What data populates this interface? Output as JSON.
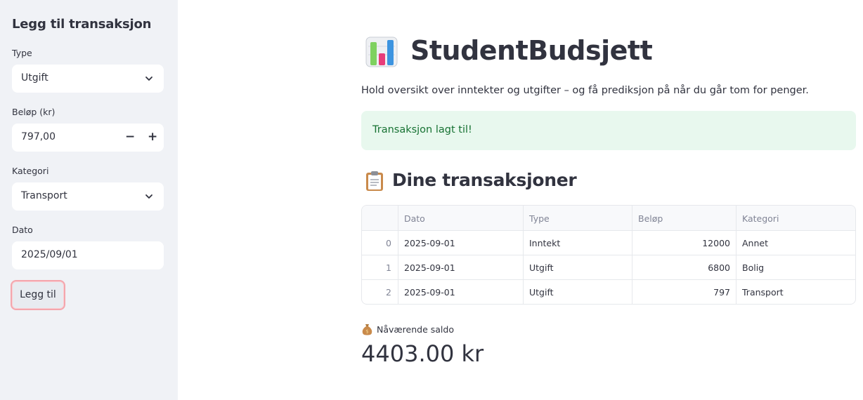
{
  "sidebar": {
    "title": "Legg til transaksjon",
    "type_label": "Type",
    "type_value": "Utgift",
    "amount_label": "Beløp (kr)",
    "amount_value": "797,00",
    "amount_decrement": "−",
    "amount_increment": "+",
    "category_label": "Kategori",
    "category_value": "Transport",
    "date_label": "Dato",
    "date_value": "2025/09/01",
    "add_button": "Legg til"
  },
  "main": {
    "title_icon": "bar-chart-icon",
    "title": "StudentBudsjett",
    "subtitle": "Hold oversikt over inntekter og utgifter – og få prediksjon på når du går tom for penger.",
    "success_message": "Transaksjon lagt til!",
    "section_icon": "clipboard-icon",
    "section_title": "Dine transaksjoner",
    "table": {
      "columns": [
        "",
        "Dato",
        "Type",
        "Beløp",
        "Kategori"
      ],
      "rows": [
        {
          "index": "0",
          "dato": "2025-09-01",
          "type": "Inntekt",
          "belop": "12000",
          "kategori": "Annet"
        },
        {
          "index": "1",
          "dato": "2025-09-01",
          "type": "Utgift",
          "belop": "6800",
          "kategori": "Bolig"
        },
        {
          "index": "2",
          "dato": "2025-09-01",
          "type": "Utgift",
          "belop": "797",
          "kategori": "Transport"
        }
      ]
    },
    "metric_icon": "money-bag-icon",
    "metric_label": "Nåværende saldo",
    "metric_value": "4403.00 kr"
  },
  "colors": {
    "sidebar_bg": "#f0f2f6",
    "success_bg": "#e8f8ee",
    "success_text": "#177233",
    "button_focus_border": "#f4a6ad"
  }
}
